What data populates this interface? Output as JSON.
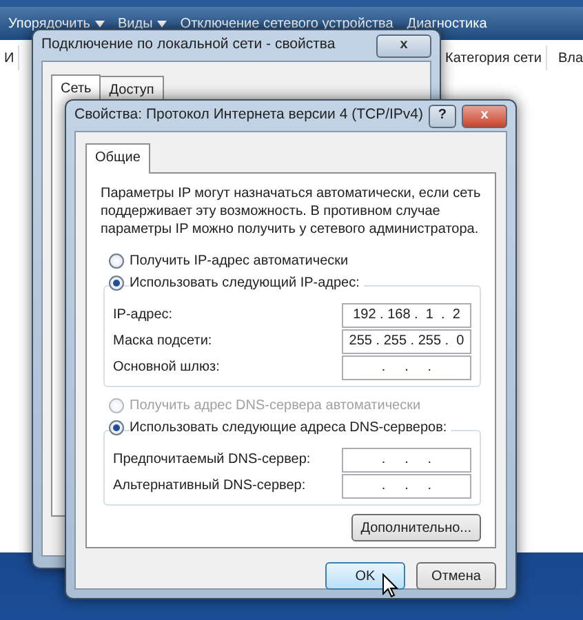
{
  "explorer": {
    "toolbar": [
      {
        "label": "Упорядочить",
        "dropdown": true
      },
      {
        "label": "Виды",
        "dropdown": true
      },
      {
        "label": "Отключение сетевого устройства",
        "dropdown": false
      },
      {
        "label": "Диагностика",
        "dropdown": false
      }
    ],
    "columns": [
      "И",
      "Категория сети",
      "Вла"
    ]
  },
  "back_window": {
    "title": "Подключение по локальной сети - свойства",
    "close_button": "x",
    "tabs": [
      {
        "label": "Сеть",
        "selected": true
      },
      {
        "label": "Доступ",
        "selected": false
      }
    ]
  },
  "dialog": {
    "title": "Свойства: Протокол Интернета версии 4 (TCP/IPv4)",
    "help_button": "?",
    "close_button": "x",
    "tabs": [
      {
        "label": "Общие",
        "selected": true
      }
    ],
    "description": "Параметры IP могут назначаться автоматически, если сеть поддерживает эту возможность. В противном случае параметры IP можно получить у сетевого администратора.",
    "ip_options": [
      {
        "label": "Получить IP-адрес автоматически",
        "selected": false,
        "disabled": false
      },
      {
        "label": "Использовать следующий IP-адрес:",
        "selected": true,
        "disabled": false
      }
    ],
    "ip_fields": [
      {
        "label": "IP-адрес:",
        "value": "192 . 168 .  1  .  2"
      },
      {
        "label": "Маска подсети:",
        "value": "255 . 255 . 255 .  0"
      },
      {
        "label": "Основной шлюз:",
        "value": "  .     .     .  "
      }
    ],
    "dns_options": [
      {
        "label": "Получить адрес DNS-сервера автоматически",
        "selected": false,
        "disabled": true
      },
      {
        "label": "Использовать следующие адреса DNS-серверов:",
        "selected": true,
        "disabled": false
      }
    ],
    "dns_fields": [
      {
        "label": "Предпочитаемый DNS-сервер:",
        "value": "  .     .     .  "
      },
      {
        "label": "Альтернативный DNS-сервер:",
        "value": "  .     .     .  "
      }
    ],
    "advanced_button": "Дополнительно...",
    "buttons": [
      {
        "label": "OK",
        "hovered": true
      },
      {
        "label": "Отмена",
        "hovered": false
      }
    ]
  }
}
